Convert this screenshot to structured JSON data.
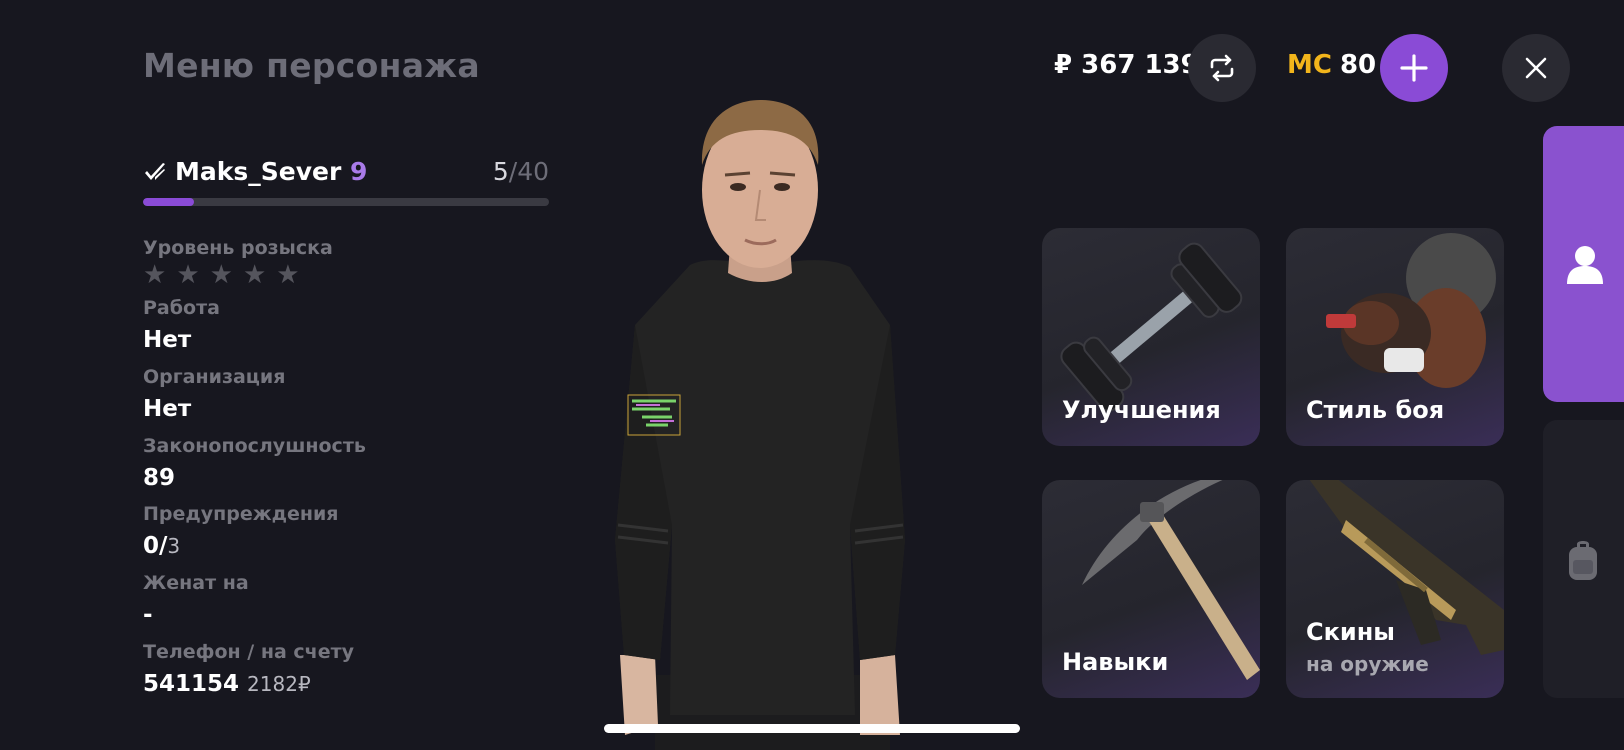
{
  "header": {
    "title": "Меню персонажа",
    "money": "₽ 367 139",
    "mc_label": "MC",
    "mc_value": "80"
  },
  "player": {
    "name": "Maks_Sever",
    "level": "9",
    "exp_current": "5",
    "exp_max": "/40",
    "exp_progress": 0.125
  },
  "stats": {
    "wanted_label": "Уровень розыска",
    "wanted_stars": 0,
    "job_label": "Работа",
    "job_value": "Нет",
    "org_label": "Организация",
    "org_value": "Нет",
    "law_label": "Законопослушность",
    "law_value": "89",
    "warn_label": "Предупреждения",
    "warn_value": "0/",
    "warn_max": "3",
    "married_label": "Женат на",
    "married_value": "-",
    "phone_label": "Телефон / на счету",
    "phone_number": "541154",
    "phone_balance": "2182₽"
  },
  "tiles": {
    "upgrades": "Улучшения",
    "fight_style": "Стиль боя",
    "skills": "Навыки",
    "skins": "Скины",
    "skins_sub": "на оружие"
  },
  "icons": {
    "exchange": "exchange-icon",
    "add": "plus-icon",
    "close": "close-icon",
    "profile": "person-icon",
    "inventory": "backpack-icon",
    "verified": "verified-check-icon"
  },
  "colors": {
    "accent": "#8a4bd6",
    "mc": "#f2b51b",
    "background": "#17171f"
  }
}
